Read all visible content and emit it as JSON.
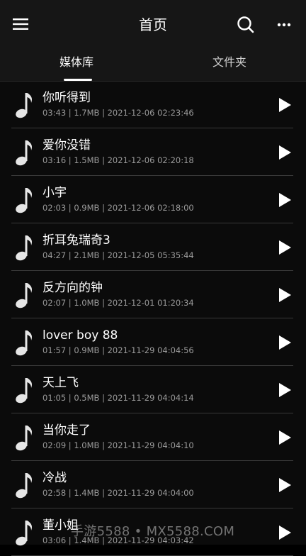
{
  "header": {
    "title": "首页",
    "menu_icon": "hamburger-menu-icon",
    "search_icon": "search-icon",
    "more_icon": "more-dots-icon"
  },
  "tabs": [
    {
      "label": "媒体库",
      "active": true
    },
    {
      "label": "文件夹",
      "active": false
    }
  ],
  "songs": [
    {
      "title": "你听得到",
      "meta": "03:43 | 1.7MB | 2021-12-06 02:23:46"
    },
    {
      "title": "爱你没错",
      "meta": "03:16 | 1.5MB | 2021-12-06 02:20:18"
    },
    {
      "title": "小宇",
      "meta": "02:03 | 0.9MB | 2021-12-06 02:18:00"
    },
    {
      "title": "折耳兔瑞奇3",
      "meta": "04:27 | 2.1MB | 2021-12-05 05:35:44"
    },
    {
      "title": "反方向的钟",
      "meta": "02:07 | 1.0MB | 2021-12-01 01:20:34"
    },
    {
      "title": "lover boy 88",
      "meta": "01:57 | 0.9MB | 2021-11-29 04:04:56"
    },
    {
      "title": "天上飞",
      "meta": "01:05 | 0.5MB | 2021-11-29 04:04:14"
    },
    {
      "title": "当你走了",
      "meta": "02:09 | 1.0MB | 2021-11-29 04:04:10"
    },
    {
      "title": "冷战",
      "meta": "02:58 | 1.4MB | 2021-11-29 04:04:00"
    },
    {
      "title": "董小姐",
      "meta": "03:06 | 1.4MB | 2021-11-29 04:03:42"
    }
  ],
  "watermark": "手游5588 • MX5588.COM",
  "colors": {
    "background": "#0b0b0b",
    "header": "#161616",
    "divider": "#3a3a3a",
    "text_primary": "#ffffff",
    "text_secondary": "#9a9a9a"
  }
}
